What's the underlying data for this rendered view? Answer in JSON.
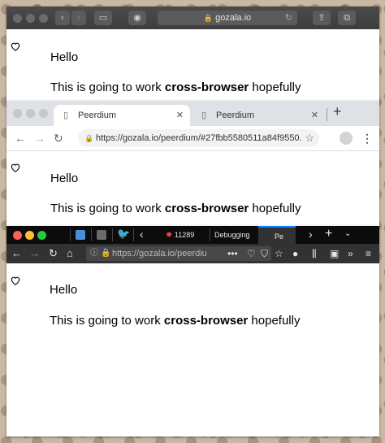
{
  "safari": {
    "url": "gozala.io",
    "lock_glyph": "🔒"
  },
  "chrome": {
    "tabs": [
      {
        "label": "Peerdium",
        "active": true
      },
      {
        "label": "Peerdium",
        "active": false
      }
    ],
    "new_tab": "+",
    "url": "https://gozala.io/peerdium/#27fbb5580511a84f9550..."
  },
  "firefox": {
    "tabs": [
      {
        "label": "11289"
      },
      {
        "label": "Debugging"
      },
      {
        "label": "Pe"
      }
    ],
    "url": "https://gozala.io/peerdiu"
  },
  "page": {
    "hello": "Hello",
    "text_before": "This is going to work ",
    "text_bold": "cross-browser",
    "text_after": " hopefully"
  },
  "colors": {
    "firefox_lock": "#2aa52a",
    "twitter": "#1da1f2",
    "close_red": "#ff5f56",
    "min_yellow": "#ffbd2e",
    "max_green": "#27c93f"
  }
}
